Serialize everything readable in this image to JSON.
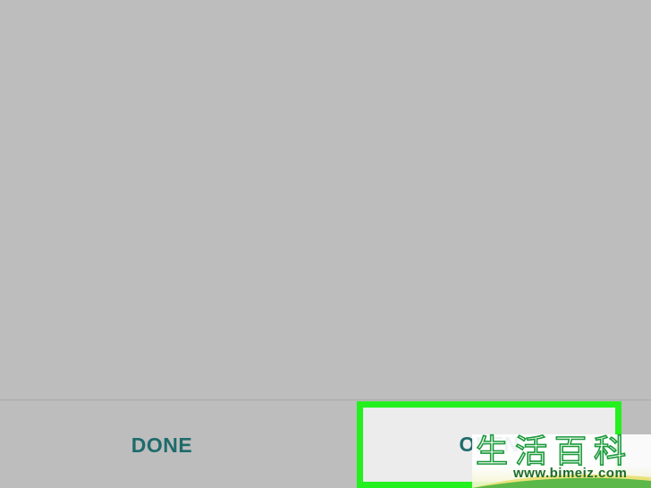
{
  "dialog": {
    "done_label": "DONE",
    "open_label": "OPEN"
  },
  "watermark": {
    "chars": "生活百科",
    "url": "www.bimeiz.com"
  },
  "colors": {
    "background": "#bdbdbd",
    "button_text": "#1f6b6b",
    "highlight_border": "#24f01f",
    "open_button_bg": "#ececec"
  }
}
